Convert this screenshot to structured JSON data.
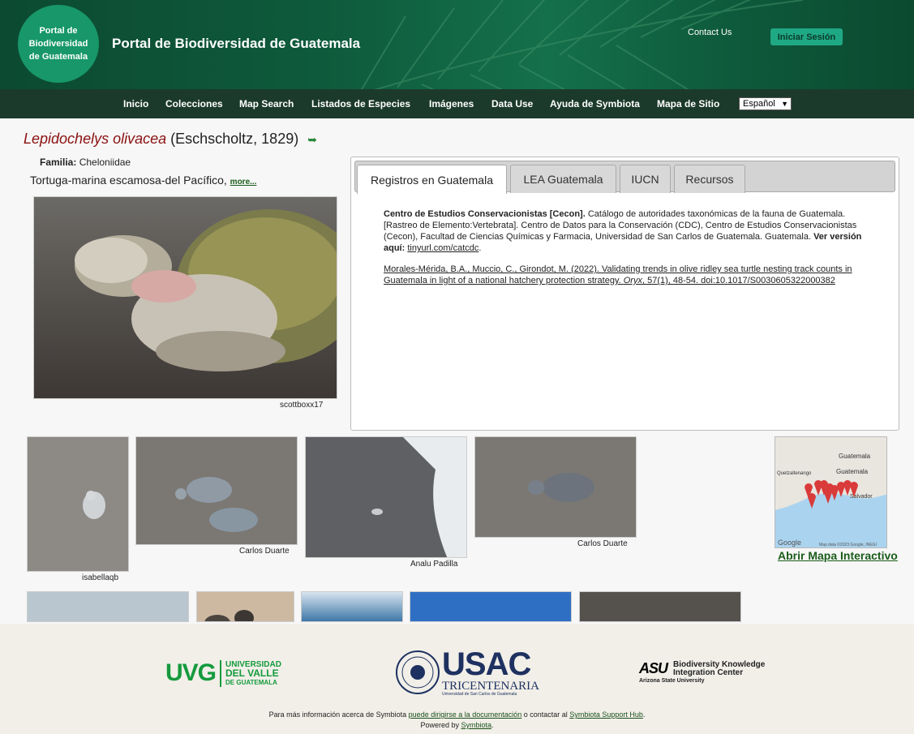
{
  "header": {
    "logo_lines": [
      "Portal de",
      "Biodiversidad",
      "de Guatemala"
    ],
    "title": "Portal de Biodiversidad de Guatemala",
    "contact": "Contact Us",
    "login": "Iniciar Sesión"
  },
  "nav": {
    "items": [
      "Inicio",
      "Colecciones",
      "Map Search",
      "Listados de Especies",
      "Imágenes",
      "Data Use",
      "Ayuda de Symbiota",
      "Mapa de Sitio"
    ],
    "language": "Español"
  },
  "species": {
    "scientific_name": "Lepidochelys olivacea",
    "author": "(Eschscholtz, 1829)",
    "family_label": "Familia:",
    "family": "Cheloniidae",
    "common_name": "Tortuga-marina escamosa-del Pacífico,",
    "more": "more...",
    "main_image_credit": "scottboxx17"
  },
  "tabs": [
    "Registros en Guatemala",
    "LEA Guatemala",
    "IUCN",
    "Recursos"
  ],
  "references": {
    "ref1_bold": "Centro de Estudios Conservacionistas [Cecon].",
    "ref1_text": " Catálogo de autoridades taxonómicas de la fauna de Guatemala. [Rastreo de Elemento:Vertebrata]. Centro de Datos para la Conservación (CDC), Centro de Estudios Conservacionistas (Cecon), Facultad de Ciencias Químicas y Farmacia, Universidad de San Carlos de Guatemala. Guatemala. ",
    "ref1_version": "Ver versión aquí:",
    "ref1_link": "tinyurl.com/catcdc",
    "ref2_pre": "Morales-Mérida, B.A., Muccio, C., Girondot, M. (2022). Validating trends in olive ridley sea turtle nesting track counts in Guatemala in light of a national hatchery protection strategy. ",
    "ref2_journal": "Oryx",
    "ref2_post": ", 57(1), 48-54. doi:10.1017/S0030605322000382"
  },
  "gallery_credits": [
    "isabellaqb",
    "Carlos Duarte",
    "Analu Padilla",
    "Carlos Duarte"
  ],
  "map": {
    "label_guatemala_top": "Guatemala",
    "label_quetzaltenango": "Quetzaltenango",
    "label_guatemala": "Guatemala",
    "label_salvador": "Salvador",
    "label_google": "Google",
    "label_mapdata": "Map data ©2023 Google, INEGI",
    "link": "Abrir Mapa Interactivo"
  },
  "footer": {
    "uvg": "UVG",
    "uvg_name": [
      "UNIVERSIDAD",
      "DEL VALLE",
      "DE GUATEMALA"
    ],
    "usac": "USAC",
    "usac_sub": "TRICENTENARIA",
    "usac_small": "Universidad de San Carlos de Guatemala",
    "asu": "ASU",
    "asu_name": [
      "Biodiversity Knowledge",
      "Integration Center"
    ],
    "asu_sub": "Arizona State University",
    "info_pre": "Para más información acerca de Symbiota ",
    "info_link1": "puede dirigirse a la documentación",
    "info_mid": " o contactar al ",
    "info_link2": "Symbiota Support Hub",
    "info_end": ".",
    "powered_pre": "Powered by ",
    "powered_link": "Symbiota",
    "powered_end": "."
  },
  "colors": {
    "header_green": "#0e5a3c",
    "nav_bg": "#1c3a2c",
    "login_btn": "#1fa884",
    "sci_name": "#8b1010",
    "link_green": "#1a5c1a"
  }
}
